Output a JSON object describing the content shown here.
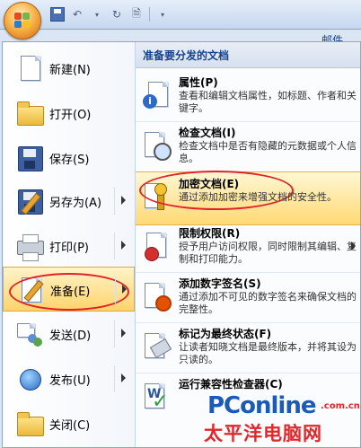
{
  "topbar": {
    "tab_mail": "邮件"
  },
  "left_menu": {
    "items": [
      {
        "label": "新建(N)",
        "icon": "new-document-icon"
      },
      {
        "label": "打开(O)",
        "icon": "open-folder-icon"
      },
      {
        "label": "保存(S)",
        "icon": "save-disk-icon"
      },
      {
        "label": "另存为(A)",
        "icon": "save-as-icon"
      },
      {
        "label": "打印(P)",
        "icon": "printer-icon"
      },
      {
        "label": "准备(E)",
        "icon": "prepare-icon",
        "selected": true
      },
      {
        "label": "发送(D)",
        "icon": "send-icon"
      },
      {
        "label": "发布(U)",
        "icon": "publish-icon"
      },
      {
        "label": "关闭(C)",
        "icon": "close-folder-icon"
      }
    ]
  },
  "right_menu": {
    "header": "准备要分发的文档",
    "items": [
      {
        "title": "属性(P)",
        "desc": "查看和编辑文档属性，如标题、作者和关键字。",
        "icon": "properties-icon"
      },
      {
        "title": "检查文档(I)",
        "desc": "检查文档中是否有隐藏的元数据或个人信息。",
        "icon": "inspect-document-icon"
      },
      {
        "title": "加密文档(E)",
        "desc": "通过添加加密来增强文档的安全性。",
        "icon": "encrypt-document-icon",
        "selected": true
      },
      {
        "title": "限制权限(R)",
        "desc": "授予用户访问权限，同时限制其编辑、复制和打印能力。",
        "icon": "restrict-permission-icon"
      },
      {
        "title": "添加数字签名(S)",
        "desc": "通过添加不可见的数字签名来确保文档的完整性。",
        "icon": "digital-signature-icon"
      },
      {
        "title": "标记为最终状态(F)",
        "desc": "让读者知晓文档是最终版本，并将其设为只读的。",
        "icon": "mark-final-icon"
      },
      {
        "title": "运行兼容性检查器(C)",
        "desc": "",
        "icon": "compatibility-checker-icon"
      }
    ]
  },
  "watermark": {
    "brand": "PConline",
    "suffix": ".com.cn",
    "subtitle": "太平洋电脑网"
  },
  "colors": {
    "accent_highlight": "#ffd36b",
    "annotation_circle": "#e0232a",
    "header_text": "#15428b"
  }
}
